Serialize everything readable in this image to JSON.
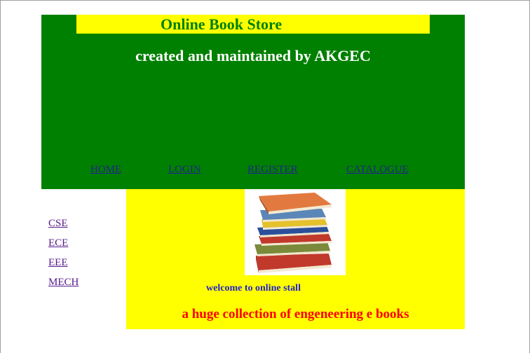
{
  "header": {
    "title": "Online Book Store",
    "subtitle": "created and maintained by AKGEC"
  },
  "nav": {
    "home": "HOME",
    "login": "LOGIN",
    "register": "REGISTER",
    "catalogue": "CATALOGUE"
  },
  "sidebar": {
    "items": [
      "CSE",
      "ECE",
      "EEE",
      "MECH"
    ]
  },
  "main": {
    "welcome": "welcome to online stall",
    "tagline": "a huge collection of engeneering e books"
  },
  "colors": {
    "header_bg": "#008000",
    "title_bar_bg": "#ffff00",
    "content_bg": "#ffff00",
    "tagline": "#ff0000",
    "welcome": "#2222cc"
  }
}
